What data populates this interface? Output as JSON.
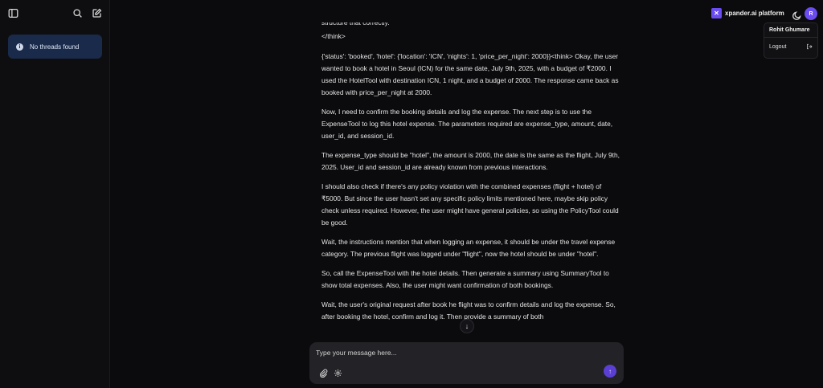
{
  "sidebar": {
    "empty_message": "No threads found"
  },
  "header": {
    "brand": "xpander.ai platform",
    "avatar_initial": "R",
    "brand_color": "#6b4cf0"
  },
  "user_menu": {
    "name": "Rohit Ghumare",
    "logout_label": "Logout"
  },
  "messages": {
    "partial_top": "structure that correctly.",
    "think_close": "</think>",
    "paragraphs": [
      "{'status': 'booked', 'hotel': {'location': 'ICN', 'nights': 1, 'price_per_night': 2000}}<think> Okay, the user wanted to book a hotel in Seoul (ICN) for the same date, July 9th, 2025, with a budget of ₹2000. I used the HotelTool with destination ICN, 1 night, and a budget of 2000. The response came back as booked with price_per_night at 2000.",
      "Now, I need to confirm the booking details and log the expense. The next step is to use the ExpenseTool to log this hotel expense. The parameters required are expense_type, amount, date, user_id, and session_id.",
      "The expense_type should be \"hotel\", the amount is 2000, the date is the same as the flight, July 9th, 2025. User_id and session_id are already known from previous interactions.",
      "I should also check if there's any policy violation with the combined expenses (flight + hotel) of ₹5000. But since the user hasn't set any specific policy limits mentioned here, maybe skip policy check unless required. However, the user might have general policies, so using the PolicyTool could be good.",
      "Wait, the instructions mention that when logging an expense, it should be under the travel expense category. The previous flight was logged under \"flight\", now the hotel should be under \"hotel\".",
      "So, call the ExpenseTool with the hotel details. Then generate a summary using SummaryTool to show total expenses. Also, the user might want confirmation of both bookings.",
      "Wait, the user's original request after book   he flight was to confirm details and log the expense. So, after booking the hotel, confirm and log it. Then provide a summary of both"
    ]
  },
  "composer": {
    "placeholder": "Type your message here..."
  }
}
